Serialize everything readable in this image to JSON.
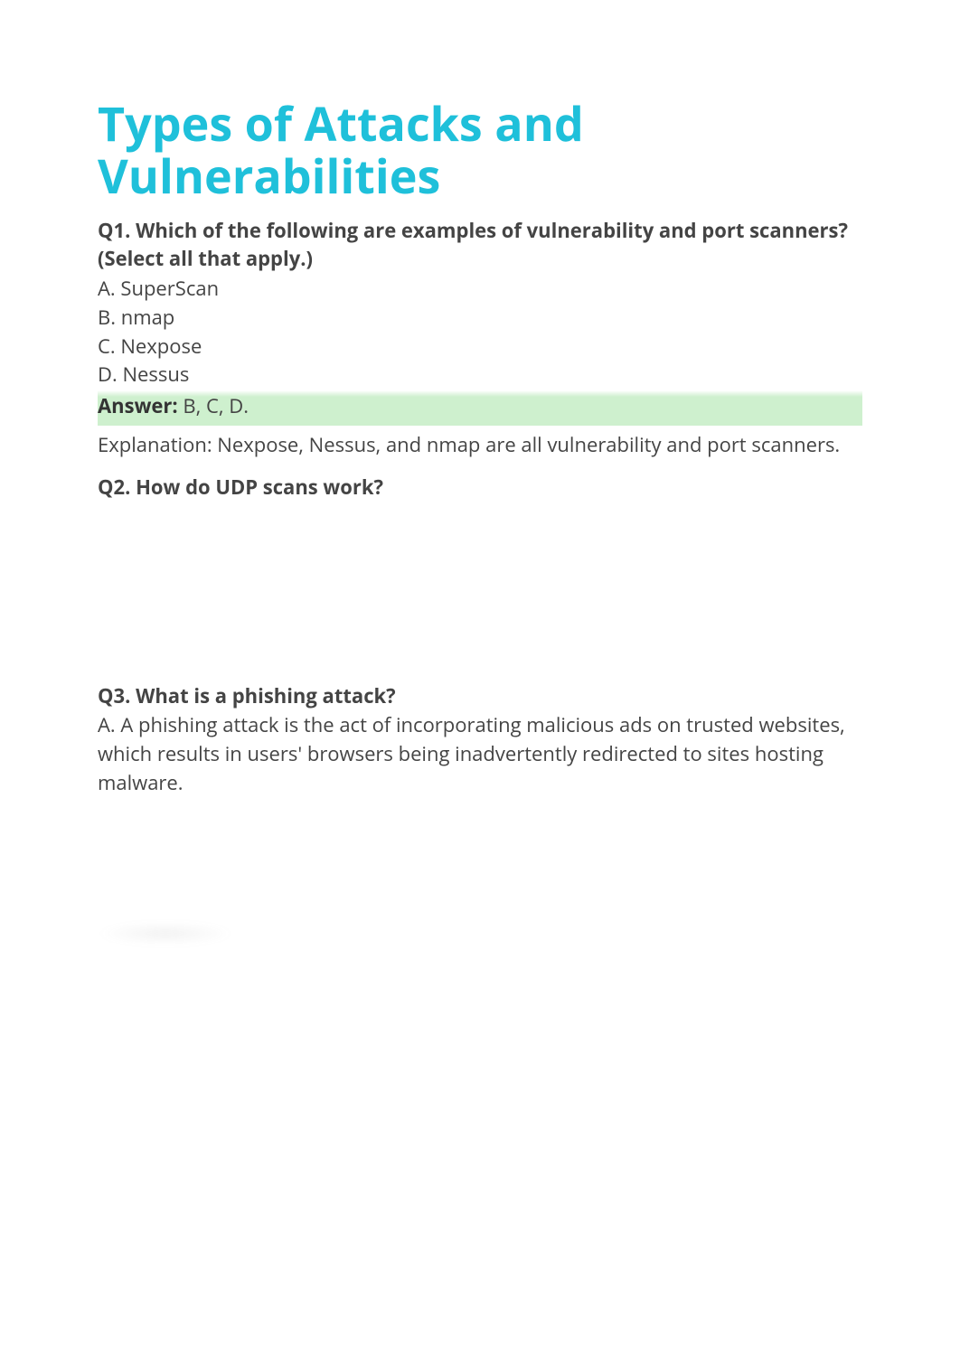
{
  "title": "Types of Attacks and Vulnerabilities",
  "q1": {
    "prompt": "Q1. Which of the following are examples of vulnerability and port scanners? (Select all that apply.)",
    "options": {
      "a": "A. SuperScan",
      "b": "B. nmap",
      "c": "C. Nexpose",
      "d": "D. Nessus"
    },
    "answer_label": "Answer:",
    "answer_value": " B, C, D.",
    "explanation": "Explanation: Nexpose, Nessus, and nmap are all vulnerability and port scanners."
  },
  "q2": {
    "prompt": "Q2. How do UDP scans work?"
  },
  "q3": {
    "prompt": "Q3. What is a phishing attack?",
    "option_a": "A. A phishing attack is the act of incorporating malicious ads on trusted websites, which results in users' browsers being inadvertently redirected to sites hosting malware."
  }
}
